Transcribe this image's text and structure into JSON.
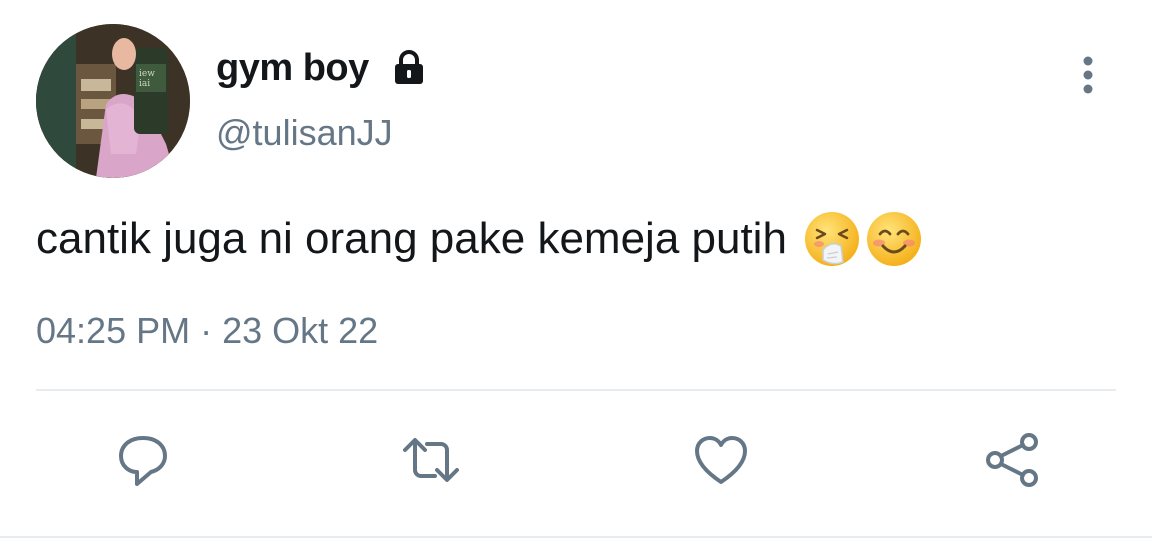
{
  "tweet": {
    "display_name": "gym boy",
    "handle": "@tulisanJJ",
    "text": "cantik juga ni orang pake kemeja putih",
    "emojis": [
      "sneezing-face-emoji",
      "smiling-face-emoji"
    ],
    "timestamp": "04:25 PM · 23 Okt 22"
  },
  "icons": {
    "lock": "lock-icon",
    "more": "more-vertical-icon",
    "reply": "reply-icon",
    "retweet": "retweet-icon",
    "like": "heart-icon",
    "share": "share-icon"
  },
  "colors": {
    "text_primary": "#14171a",
    "text_secondary": "#657786",
    "divider": "#e6ecf0"
  }
}
